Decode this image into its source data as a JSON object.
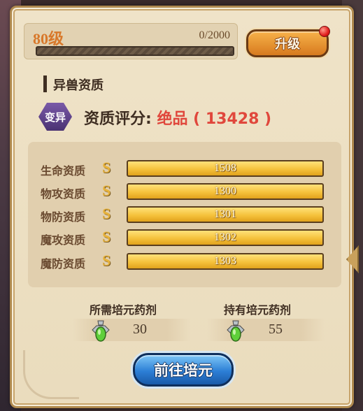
{
  "level": {
    "label": "80级",
    "exp_text": "0/2000",
    "exp_progress": 0
  },
  "upgrade_button": {
    "label": "升级"
  },
  "section": {
    "title": "异兽资质"
  },
  "mutation": {
    "badge": "变异",
    "score_label": "资质评分: ",
    "score_value": "绝品 ( 13428 )"
  },
  "stats": [
    {
      "label": "生命资质",
      "grade": "S",
      "value": "1508"
    },
    {
      "label": "物攻资质",
      "grade": "S",
      "value": "1300"
    },
    {
      "label": "物防资质",
      "grade": "S",
      "value": "1301"
    },
    {
      "label": "魔攻资质",
      "grade": "S",
      "value": "1302"
    },
    {
      "label": "魔防资质",
      "grade": "S",
      "value": "1303"
    }
  ],
  "potions": {
    "required_title": "所需培元药剂",
    "required_value": "30",
    "owned_title": "持有培元药剂",
    "owned_value": "55",
    "icon": "potion-bottle-icon"
  },
  "go_button": {
    "label": "前往培元"
  },
  "colors": {
    "accent_orange": "#d8782a",
    "score_red": "#e0473c",
    "bar_gold": "#f5c23c",
    "button_blue": "#2c7fd6"
  }
}
